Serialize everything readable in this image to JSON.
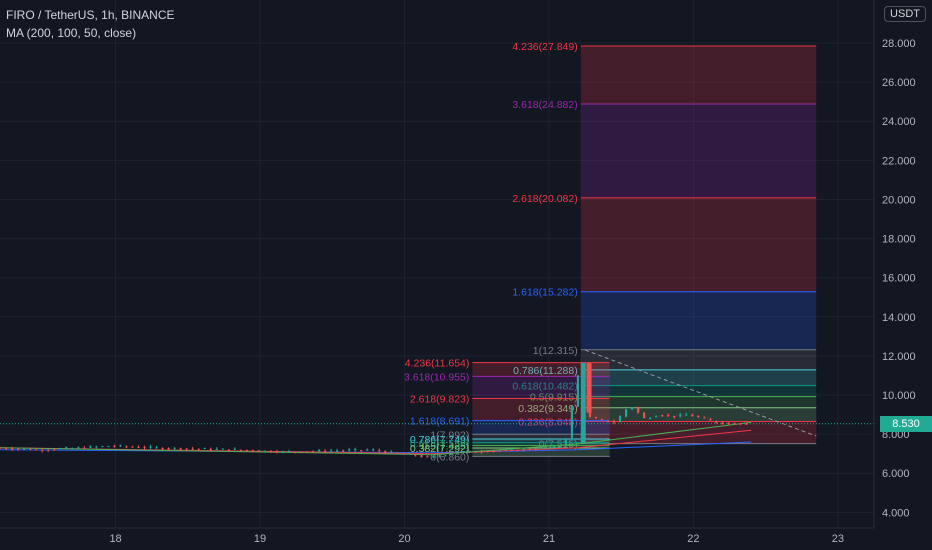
{
  "header": {
    "symbol_line": "FIRO / TetherUS, 1h, BINANCE",
    "indicator_line": "MA (200, 100, 50, close)"
  },
  "currency_button": "USDT",
  "last_price": "8.530",
  "colors": {
    "background": "#131722",
    "candle_up": "#26a69a",
    "candle_down": "#ef5350",
    "fib_red": "#f23645",
    "fib_purple": "#9c27b0",
    "fib_blue": "#2962ff",
    "fib_gray": "#787b86",
    "fib_teal": "#089981",
    "fib_orange": "#ff9800",
    "price_tag": "#22ab94"
  },
  "chart_data": {
    "type": "candlestick",
    "title": "FIRO / TetherUS, 1h, BINANCE",
    "indicator": "MA (200, 100, 50, close)",
    "x_tick_labels": [
      "18",
      "19",
      "20",
      "21",
      "22",
      "23"
    ],
    "y_tick_labels": [
      "4.000",
      "6.000",
      "8.000",
      "10.000",
      "12.000",
      "14.000",
      "16.000",
      "18.000",
      "20.000",
      "22.000",
      "24.000",
      "26.000",
      "28.000"
    ],
    "ylim": [
      3.2,
      30.2
    ],
    "xlim": [
      17.2,
      23.25
    ],
    "grid": true,
    "last_price": 8.53,
    "price_path": [
      [
        17.2,
        7.3
      ],
      [
        17.5,
        7.2
      ],
      [
        17.8,
        7.3
      ],
      [
        18.0,
        7.4
      ],
      [
        18.3,
        7.3
      ],
      [
        18.6,
        7.25
      ],
      [
        18.9,
        7.2
      ],
      [
        19.2,
        7.1
      ],
      [
        19.5,
        7.15
      ],
      [
        19.8,
        7.2
      ],
      [
        20.0,
        7.0
      ],
      [
        20.1,
        6.95
      ],
      [
        20.2,
        6.8
      ],
      [
        20.35,
        7.0
      ],
      [
        20.5,
        7.1
      ],
      [
        20.8,
        7.2
      ],
      [
        21.05,
        7.3
      ],
      [
        21.15,
        7.5
      ],
      [
        21.25,
        11.3
      ],
      [
        21.3,
        8.9
      ],
      [
        21.4,
        8.7
      ],
      [
        21.5,
        8.6
      ],
      [
        21.6,
        9.5
      ],
      [
        21.7,
        8.8
      ],
      [
        21.8,
        9.0
      ],
      [
        21.9,
        8.9
      ],
      [
        22.0,
        9.0
      ],
      [
        22.1,
        8.8
      ],
      [
        22.2,
        8.6
      ],
      [
        22.3,
        8.55
      ],
      [
        22.4,
        8.53
      ]
    ],
    "ma_lines": [
      {
        "name": "MA200",
        "color": "#2962ff",
        "points": [
          [
            17.2,
            7.2
          ],
          [
            20.2,
            7.05
          ],
          [
            21.2,
            7.2
          ],
          [
            22.4,
            7.6
          ]
        ]
      },
      {
        "name": "MA100",
        "color": "#f23645",
        "points": [
          [
            17.2,
            7.3
          ],
          [
            20.2,
            7.0
          ],
          [
            21.2,
            7.3
          ],
          [
            22.4,
            8.2
          ]
        ]
      },
      {
        "name": "MA50",
        "color": "#4caf50",
        "points": [
          [
            17.2,
            7.3
          ],
          [
            20.2,
            6.95
          ],
          [
            21.2,
            7.5
          ],
          [
            22.4,
            8.6
          ]
        ]
      }
    ],
    "fib_extensions": [
      {
        "x_start": 21.22,
        "x_end": 22.85,
        "label_side": "left",
        "levels": [
          {
            "ratio": "4.236",
            "price": 27.849,
            "label": "4.236(27.849)",
            "color": "#f23645"
          },
          {
            "ratio": "3.618",
            "price": 24.882,
            "label": "3.618(24.882)",
            "color": "#9c27b0"
          },
          {
            "ratio": "2.618",
            "price": 20.082,
            "label": "2.618(20.082)",
            "color": "#f23645"
          },
          {
            "ratio": "1.618",
            "price": 15.282,
            "label": "1.618(15.282)",
            "color": "#2962ff"
          },
          {
            "ratio": "1",
            "price": 12.315,
            "label": "1(12.315)",
            "color": "#787b86"
          },
          {
            "ratio": "0.786",
            "price": 11.288,
            "label": "0.786(11.288)",
            "color": "#4dd0e1"
          },
          {
            "ratio": "0.618",
            "price": 10.482,
            "label": "0.618(10.482)",
            "color": "#089981"
          },
          {
            "ratio": "0.5",
            "price": 9.915,
            "label": "0.5(9.915)",
            "color": "#4caf50"
          },
          {
            "ratio": "0.382",
            "price": 9.349,
            "label": "0.382(9.349)",
            "color": "#81c784"
          },
          {
            "ratio": "0.236",
            "price": 8.648,
            "label": "0.236(8.648)",
            "color": "#f23645"
          },
          {
            "ratio": "0",
            "price": 7.515,
            "label": "0(7.515)",
            "color": "#787b86"
          }
        ]
      },
      {
        "x_start": 20.47,
        "x_end": 21.42,
        "label_side": "left",
        "levels": [
          {
            "ratio": "4.236",
            "price": 11.654,
            "label": "4.236(11.654)",
            "color": "#f23645"
          },
          {
            "ratio": "3.618",
            "price": 10.955,
            "label": "3.618(10.955)",
            "color": "#9c27b0"
          },
          {
            "ratio": "2.618",
            "price": 9.823,
            "label": "2.618(9.823)",
            "color": "#f23645"
          },
          {
            "ratio": "1.618",
            "price": 8.691,
            "label": "1.618(8.691)",
            "color": "#2962ff"
          },
          {
            "ratio": "1",
            "price": 7.992,
            "label": "1(7.992)",
            "color": "#787b86"
          },
          {
            "ratio": "0.786",
            "price": 7.749,
            "label": "0.786(7.749)",
            "color": "#4dd0e1"
          },
          {
            "ratio": "0.618",
            "price": 7.559,
            "label": "0.618(7.559)",
            "color": "#089981"
          },
          {
            "ratio": "0.5",
            "price": 7.425,
            "label": "0.5(7.425)",
            "color": "#4caf50"
          },
          {
            "ratio": "0.382",
            "price": 7.292,
            "label": "0.382(7.292)",
            "color": "#81c784"
          },
          {
            "ratio": "0",
            "price": 6.86,
            "label": "0(6.860)",
            "color": "#787b86"
          }
        ]
      }
    ],
    "dashed_trendline": [
      [
        21.25,
        12.3
      ],
      [
        22.85,
        7.9
      ]
    ]
  }
}
